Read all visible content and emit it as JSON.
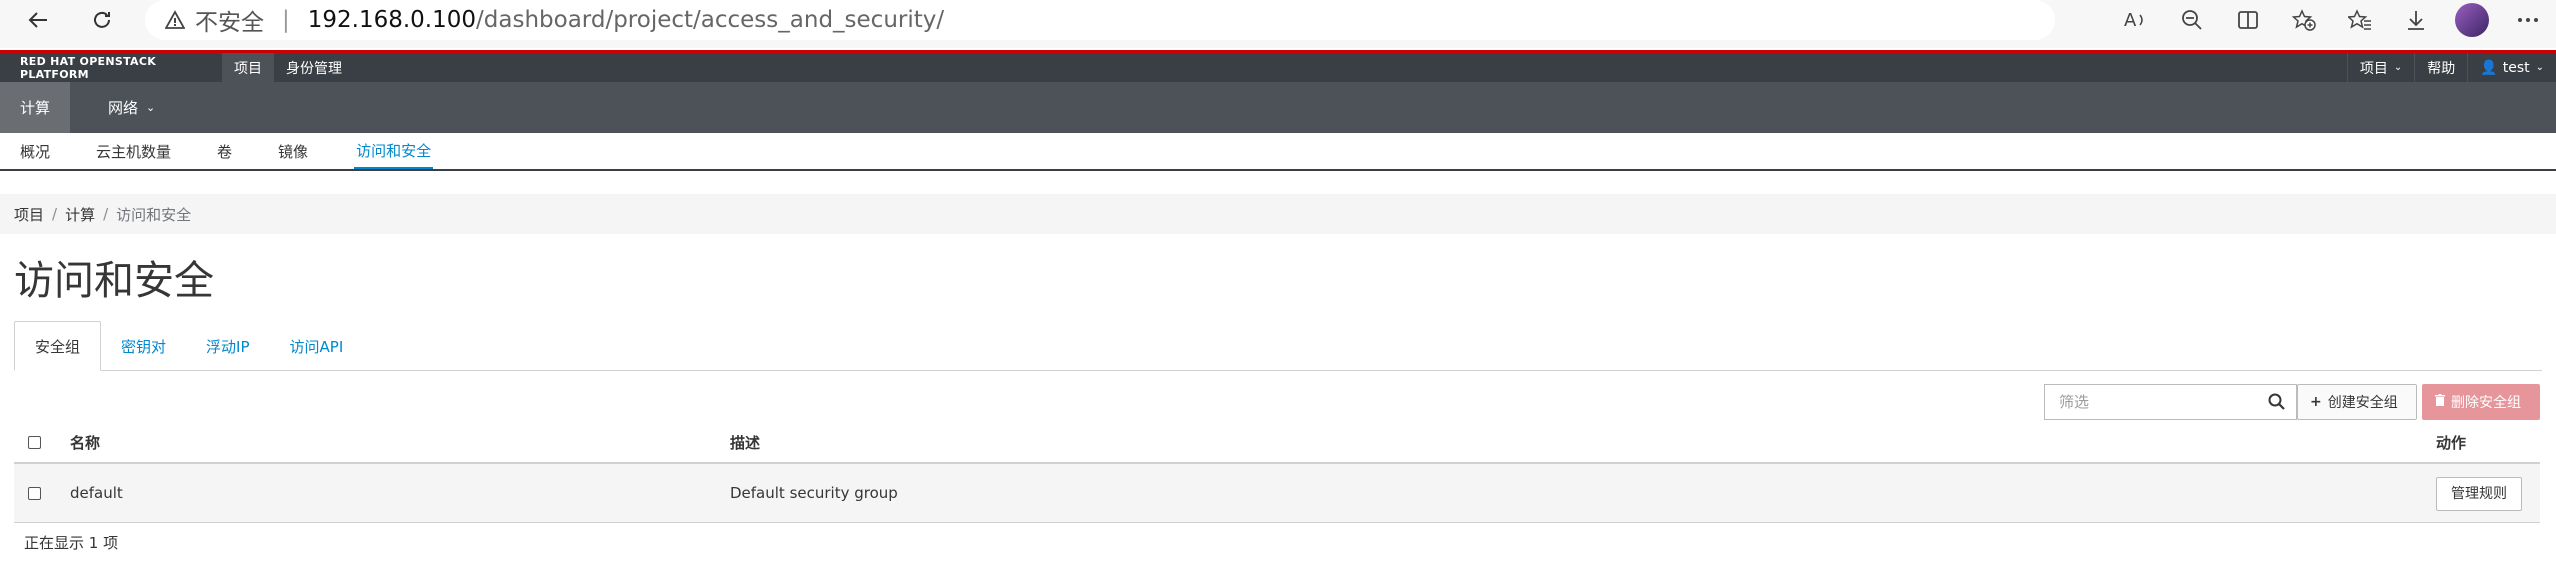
{
  "browser": {
    "security_label": "不安全",
    "url_host": "192.168.0.100",
    "url_path": "/dashboard/project/access_and_security/"
  },
  "header": {
    "brand": "RED HAT OPENSTACK PLATFORM",
    "top_tabs": [
      {
        "label": "项目"
      },
      {
        "label": "身份管理"
      }
    ],
    "right_menu": {
      "project": "项目",
      "help": "帮助",
      "user": "test"
    }
  },
  "second_nav": {
    "items": [
      {
        "label": "计算"
      },
      {
        "label": "网络"
      }
    ]
  },
  "third_nav": {
    "items": [
      {
        "label": "概况"
      },
      {
        "label": "云主机数量"
      },
      {
        "label": "卷"
      },
      {
        "label": "镜像"
      },
      {
        "label": "访问和安全"
      }
    ]
  },
  "breadcrumb": {
    "items": [
      {
        "label": "项目"
      },
      {
        "label": "计算"
      }
    ],
    "current": "访问和安全"
  },
  "page_title": "访问和安全",
  "content_tabs": [
    {
      "label": "安全组"
    },
    {
      "label": "密钥对"
    },
    {
      "label": "浮动IP"
    },
    {
      "label": "访问API"
    }
  ],
  "filter": {
    "placeholder": "筛选"
  },
  "actions": {
    "create": "创建安全组",
    "delete": "删除安全组"
  },
  "table": {
    "headers": {
      "name": "名称",
      "description": "描述",
      "actions": "动作"
    },
    "rows": [
      {
        "name": "default",
        "description": "Default security group",
        "action": "管理规则"
      }
    ]
  },
  "footer": {
    "count_text": "正在显示 1 项"
  },
  "colors": {
    "accent": "#0088ce",
    "danger": "#e6969b",
    "header_bg": "#393f44",
    "brand_red": "#cc0000"
  }
}
